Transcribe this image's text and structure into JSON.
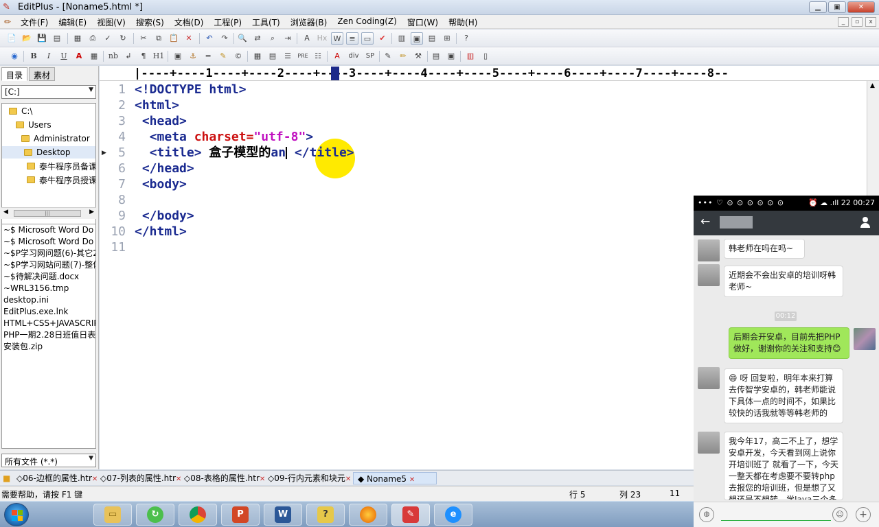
{
  "window": {
    "title": "EditPlus - [Noname5.html *]"
  },
  "menu": [
    "文件(F)",
    "编辑(E)",
    "视图(V)",
    "搜索(S)",
    "文档(D)",
    "工程(P)",
    "工具(T)",
    "浏览器(B)",
    "Zen Coding(Z)",
    "窗口(W)",
    "帮助(H)"
  ],
  "toolbar2_labels": {
    "bold": "B",
    "italic": "I",
    "underline": "U",
    "font_color": "A",
    "nobr": "nb",
    "br": "↲",
    "para": "¶",
    "heading": "H1",
    "pre": "PRE",
    "div": "div",
    "span": "SP"
  },
  "left_panel": {
    "tabs": [
      "目录",
      "素材"
    ],
    "drive": "[C:]",
    "tree": [
      "C:\\",
      "Users",
      "Administrator",
      "Desktop",
      "泰牛程序员备课",
      "泰牛程序员授课"
    ],
    "files": [
      "~$ Microsoft Word Do",
      "~$ Microsoft Word Do",
      "~$P学习网问题(6)-其它2",
      "~$P学习网站问题(7)-整体",
      "~$待解决问题.docx",
      "~WRL3156.tmp",
      "desktop.ini",
      "EditPlus.exe.lnk",
      "HTML+CSS+JAVASCRIP",
      "PHP一期2.28日班值日表.",
      "安装包.zip"
    ],
    "filter": "所有文件 (*.*)"
  },
  "ruler": {
    "text": "|----+----1----+----2----+----3----+----4----+----5----+----6----+----7----+----8--"
  },
  "editor": {
    "line_numbers": [
      "1",
      "2",
      "3",
      "4",
      "5",
      "6",
      "7",
      "8",
      "9",
      "10",
      "11"
    ],
    "doctype": "<!DOCTYPE html>",
    "html_open": "<html>",
    "head_open": "<head>",
    "meta_tag": "<meta",
    "meta_attr": "charset=",
    "meta_val": "\"utf-8\"",
    "meta_close": ">",
    "title_open": "<title>",
    "title_text": "盒子模型的",
    "title_typed": "an",
    "title_close": "</title>",
    "head_close": "</head>",
    "body_open": "<body>",
    "body_close": "</body>",
    "html_close": "</html>"
  },
  "doc_tabs": [
    "06-边框的属性.htr",
    "07-列表的属性.htr",
    "08-表格的属性.htr",
    "09-行内元素和块元",
    "Noname5"
  ],
  "status": {
    "help": "需要帮助，请按 F1 键",
    "line": "行 5",
    "col": "列 23",
    "num": "11"
  },
  "phone": {
    "status_icons": "••• ♡ ⊙ ⊙ ⊙ ⊙ ⊙ ⊙",
    "clock": "⏰ ☁ .ıll 22 00:27",
    "messages": [
      {
        "text": "韩老师在吗在吗~"
      },
      {
        "text": "近期会不会出安卓的培训呀韩老师~"
      },
      {
        "time": "00:12"
      },
      {
        "text": "后期会开安卓，目前先把PHP做好，谢谢你的关注和支持😊"
      },
      {
        "text": "😄 呀 回复啦，明年本来打算去传智学安卓的，韩老师能说下具体一点的时间不，如果比较快的话我就等等韩老师的"
      },
      {
        "text": "我今年17，高二不上了，想学安卓开发，今天看到网上说你开培训班了 就看了一下，今天一整天都在考虑要不要转php去报您的培训班，但是想了又想还是不想转，学Java三个多"
      }
    ]
  },
  "colors": {
    "tag": "#1a2a90",
    "attribute": "#cc1010",
    "value": "#c010c0",
    "highlight": "#ffea00",
    "wechat_green": "#a0e75a"
  }
}
